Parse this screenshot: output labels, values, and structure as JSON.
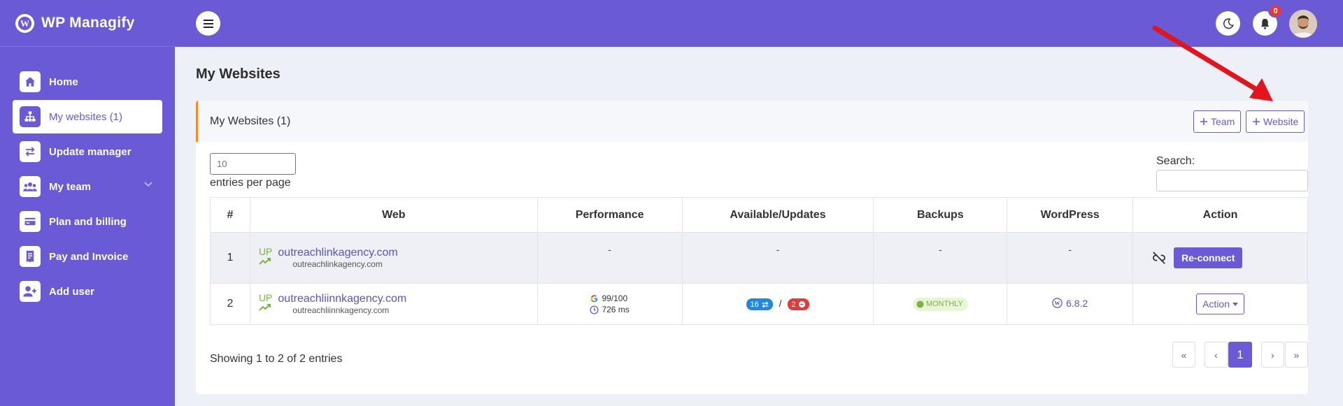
{
  "brand": {
    "title": "WP Managify"
  },
  "sidebar": {
    "items": [
      {
        "label": "Home",
        "icon": "home-icon"
      },
      {
        "label": "My websites (1)",
        "icon": "sitemap-icon"
      },
      {
        "label": "Update manager",
        "icon": "swap-icon"
      },
      {
        "label": "My team",
        "icon": "users-icon"
      },
      {
        "label": "Plan and billing",
        "icon": "credit-card-icon"
      },
      {
        "label": "Pay and Invoice",
        "icon": "receipt-icon"
      },
      {
        "label": "Add user",
        "icon": "user-plus-icon"
      }
    ]
  },
  "topbar": {
    "notifications_count": "0"
  },
  "page": {
    "title": "My Websites"
  },
  "card": {
    "title": "My Websites (1)",
    "team_button": "Team",
    "website_button": "Website"
  },
  "controls": {
    "entries_placeholder": "10",
    "entries_label": "entries per page",
    "search_label": "Search:"
  },
  "table": {
    "headers": [
      "#",
      "Web",
      "Performance",
      "Available/Updates",
      "Backups",
      "WordPress",
      "Action"
    ],
    "rows": [
      {
        "num": "1",
        "status": "UP",
        "domain": "outreachlinkagency.com",
        "sub": "outreachlinkagency.com",
        "performance": "-",
        "updates": "-",
        "backups": "-",
        "wordpress": "-",
        "action": "Re-connect"
      },
      {
        "num": "2",
        "status": "UP",
        "domain": "outreachliinnkagency.com",
        "sub": "outreachliinnkagency.com",
        "score": "99/100",
        "load_time": "726 ms",
        "updates_available": "16",
        "issues": "2",
        "slash": "/",
        "backups": "MONTHLY",
        "wordpress": "6.8.2",
        "action": "Action"
      }
    ]
  },
  "footer": {
    "showing": "Showing 1 to 2 of 2 entries",
    "pager": {
      "first": "«",
      "prev": "‹",
      "current": "1",
      "next": "›",
      "last": "»"
    }
  },
  "colors": {
    "primary": "#6a5ad6",
    "accent": "#f28c28",
    "success": "#7cb342",
    "danger": "#e53935",
    "info": "#1e88e5",
    "annotation": "#e3141b"
  }
}
